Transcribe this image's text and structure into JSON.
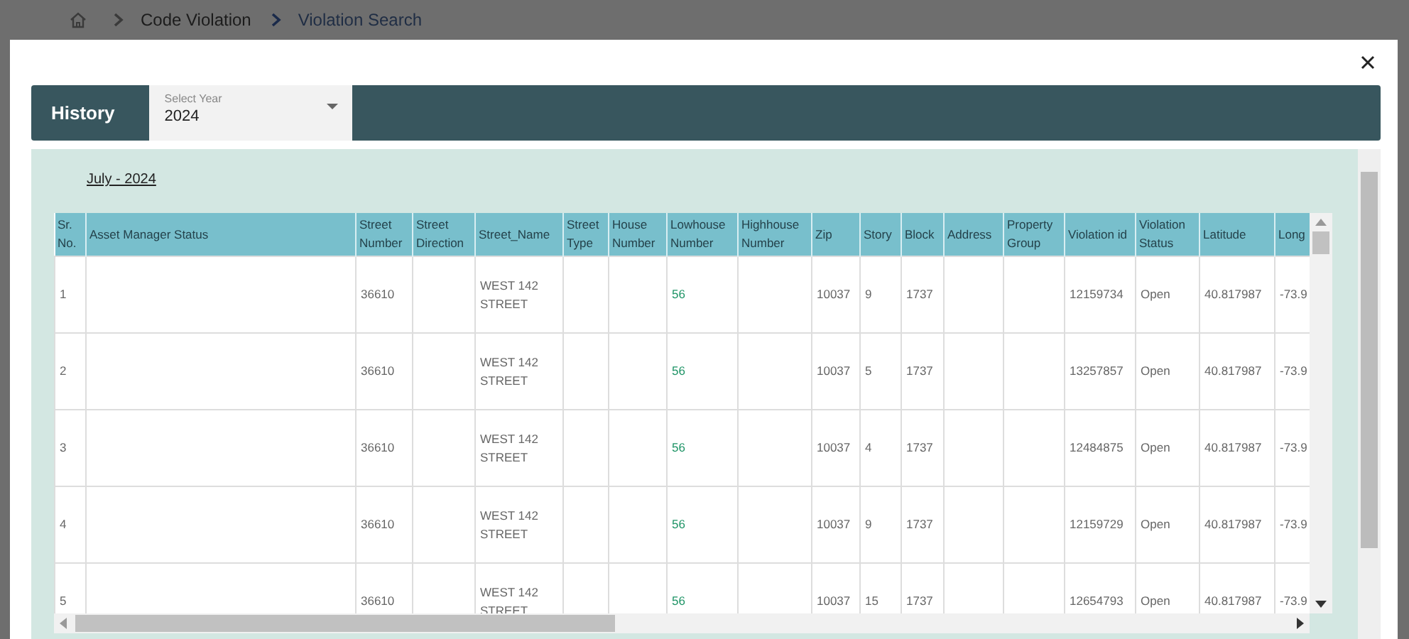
{
  "breadcrumb": {
    "items": [
      "Code Violation",
      "Violation Search"
    ]
  },
  "dialog": {
    "title": "History",
    "year_select": {
      "label": "Select Year",
      "value": "2024"
    },
    "period": "July - 2024",
    "table": {
      "columns": [
        {
          "label": "Sr. No.",
          "kind": "text"
        },
        {
          "label": "Asset Manager Status",
          "kind": "text"
        },
        {
          "label": "Street Number",
          "kind": "text"
        },
        {
          "label": "Street Direction",
          "kind": "text"
        },
        {
          "label": "Street_Name",
          "kind": "text"
        },
        {
          "label": "Street Type",
          "kind": "text"
        },
        {
          "label": "House Number",
          "kind": "text"
        },
        {
          "label": "Lowhouse Number",
          "kind": "link"
        },
        {
          "label": "Highhouse Number",
          "kind": "text"
        },
        {
          "label": "Zip",
          "kind": "text"
        },
        {
          "label": "Story",
          "kind": "text"
        },
        {
          "label": "Block",
          "kind": "text"
        },
        {
          "label": "Address",
          "kind": "text"
        },
        {
          "label": "Property Group",
          "kind": "text"
        },
        {
          "label": "Violation id",
          "kind": "text"
        },
        {
          "label": "Violation Status",
          "kind": "text"
        },
        {
          "label": "Latitude",
          "kind": "text"
        },
        {
          "label": "Long",
          "kind": "text"
        }
      ],
      "rows": [
        [
          "1",
          null,
          "36610",
          null,
          "WEST 142 STREET",
          null,
          null,
          "56",
          null,
          "10037",
          "9",
          "1737",
          null,
          null,
          "12159734",
          "Open",
          "40.817987",
          "-73.9"
        ],
        [
          "2",
          null,
          "36610",
          null,
          "WEST 142 STREET",
          null,
          null,
          "56",
          null,
          "10037",
          "5",
          "1737",
          null,
          null,
          "13257857",
          "Open",
          "40.817987",
          "-73.9"
        ],
        [
          "3",
          null,
          "36610",
          null,
          "WEST 142 STREET",
          null,
          null,
          "56",
          null,
          "10037",
          "4",
          "1737",
          null,
          null,
          "12484875",
          "Open",
          "40.817987",
          "-73.9"
        ],
        [
          "4",
          null,
          "36610",
          null,
          "WEST 142 STREET",
          null,
          null,
          "56",
          null,
          "10037",
          "9",
          "1737",
          null,
          null,
          "12159729",
          "Open",
          "40.817987",
          "-73.9"
        ],
        [
          "5",
          null,
          "36610",
          null,
          "WEST 142 STREET",
          null,
          null,
          "56",
          null,
          "10037",
          "15",
          "1737",
          null,
          null,
          "12654793",
          "Open",
          "40.817987",
          "-73.9"
        ]
      ]
    }
  }
}
